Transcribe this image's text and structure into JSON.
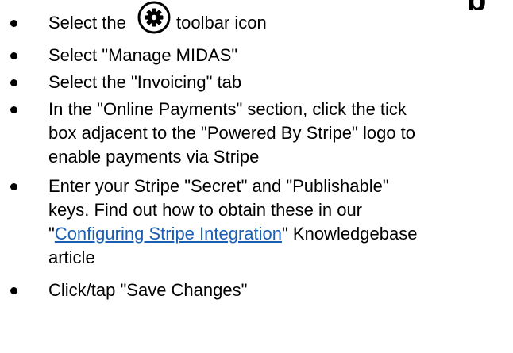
{
  "steps": [
    {
      "before": "Select the",
      "icon": "gear-icon",
      "after": "toolbar icon"
    },
    {
      "text": "Select \"Manage MIDAS\""
    },
    {
      "text": "Select the \"Invoicing\" tab"
    },
    {
      "lines": [
        "In the \"Online Payments\" section, click the tick",
        "box adjacent to the \"Powered By Stripe\" logo to",
        "enable payments via Stripe"
      ]
    },
    {
      "line1": "Enter your Stripe \"Secret\" and \"Publishable\"",
      "line2": "keys. Find out how to obtain these in our",
      "line3_prefix": "\"",
      "link": "Configuring Stripe Integration",
      "line3_suffix": "\" Knowledgebase",
      "line4": "article"
    },
    {
      "text": "Click/tap \"Save Changes\""
    }
  ],
  "colors": {
    "text": "#000000",
    "link": "#1a5fb4",
    "bullet": "#000000"
  }
}
